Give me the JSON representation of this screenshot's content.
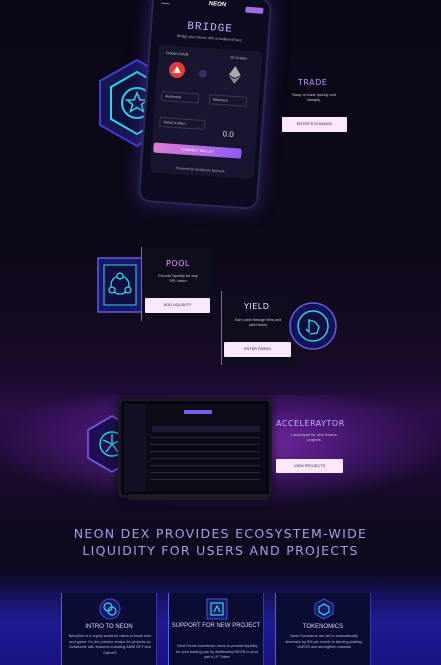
{
  "phone": {
    "logo": "NEON",
    "title": "BRIDGE",
    "subtitle": "Bridge your tokens with a traditional fees",
    "from_label": "FROM CHAIN",
    "to_label": "TO CHAIN",
    "from_select": "Avalanche",
    "to_select": "Ethereum",
    "token_select": "Select a token",
    "amount": "0.0",
    "connect_label": "CONNECT WALLET",
    "footer": "Powered by Multichain Network"
  },
  "trade": {
    "title": "TRADE",
    "desc": "Swap or trade quickly and cheaply.",
    "button": "ENTER EXCHANGE"
  },
  "pool": {
    "title": "POOL",
    "desc": "Provide liquidity for any SPL token",
    "button": "ADD LIQUIDITY"
  },
  "yield": {
    "title": "YIELD",
    "desc": "Earn yield through fees and yield farms",
    "button": "ENTER FARMS"
  },
  "accelerator": {
    "title": "ACCELERAYTOR",
    "desc": "Launchpad for new Solana projects",
    "button": "VIEW PROJECTS"
  },
  "headline": {
    "line1": "NEON DEX PROVIDES ECOSYSTEM-WIDE",
    "line2": "LIQUIDITY FOR USERS AND PROJECTS"
  },
  "cards": [
    {
      "title": "INTRO TO NEON",
      "text": "NeonDex is a crypto world for users to trade earn and game. It's the premier choice for projects on Avalanche with features including AMM NFT and GameFi"
    },
    {
      "title": "SUPPORT FOR NEW PROJECT",
      "text": "Yield Farms incentivize users to provide liquidity for your trading pair by distributing NEON to your pair's LP Token"
    },
    {
      "title": "TOKENOMICS",
      "text": "Neon Emissions are set to automatically decrease by 8% per month to farming staking, xNEON and strengthen rewards"
    }
  ],
  "colors": {
    "accent": "#8e5cf4",
    "pink": "#e07cd4",
    "cyan": "#3ce0e8",
    "headline": "#a69ee6"
  }
}
